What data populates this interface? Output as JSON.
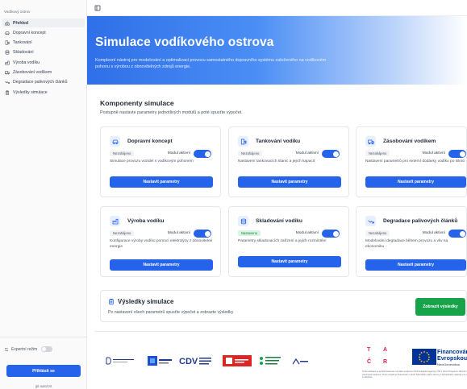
{
  "sidebar": {
    "title": "Vodíkový ostrov",
    "items": [
      {
        "label": "Přehled",
        "icon": "home-icon",
        "active": true
      },
      {
        "label": "Dopravní koncept",
        "icon": "car-icon",
        "active": false
      },
      {
        "label": "Tankování",
        "icon": "fuel-icon",
        "active": false
      },
      {
        "label": "Skladování",
        "icon": "database-icon",
        "active": false
      },
      {
        "label": "Výroba vodíku",
        "icon": "factory-icon",
        "active": false
      },
      {
        "label": "Zásobování vodíkem",
        "icon": "truck-icon",
        "active": false
      },
      {
        "label": "Degradace palivových článků",
        "icon": "trending-down-icon",
        "active": false
      },
      {
        "label": "Výsledky simulace",
        "icon": "clipboard-icon",
        "active": false
      }
    ],
    "expert_mode_label": "Expertní režim",
    "login_label": "Přihlásit se",
    "user_text": "git auto/1st"
  },
  "hero": {
    "title": "Simulace vodíkového ostrova",
    "description": "Komplexní nástroj pro modelování a optimalizaci provozu samostatného dopravního systému založeného na vodíkovém pohonu s výrobou z obnovitelných zdrojů energie."
  },
  "components": {
    "title": "Komponenty simulace",
    "subtitle": "Postupně nastavte parametry jednotlivých modulů a poté spusťte výpočet.",
    "module_active_label": "Modul aktivní",
    "button_label": "Nastavit parametry",
    "cards": [
      {
        "title": "Dopravní koncept",
        "status": "Nezahájeno",
        "desc": "Simulace provozu vozidel s vodíkovým pohonem",
        "icon": "car-icon"
      },
      {
        "title": "Tankování vodíku",
        "status": "Nezahájeno",
        "desc": "Nastavení tankovacích stanic a jejich kapacit",
        "icon": "fuel-icon"
      },
      {
        "title": "Zásobování vodíkem",
        "status": "Nezahájeno",
        "desc": "Nastavení parametrů pro externí dodávky vodíku po silnici",
        "icon": "truck-icon"
      },
      {
        "title": "Výroba vodíku",
        "status": "Nezahájeno",
        "desc": "Konfigurace výroby vodíku pomocí elektrolýzy z obnovitelné energie",
        "icon": "factory-icon"
      },
      {
        "title": "Skladování vodíku",
        "status": "Nastaveno",
        "desc": "Parametry skladovacích zařízení a jejich rozmístění",
        "icon": "database-icon"
      },
      {
        "title": "Degradace palivových článků",
        "status": "Nezahájeno",
        "desc": "Modelování degradace během provozu a vliv na ekonomiku",
        "icon": "trending-down-icon"
      }
    ]
  },
  "results": {
    "title": "Výsledky simulace",
    "description": "Po nastavení všech parametrů spusťte výpočet a zobrazte výsledky",
    "button_label": "Zobrazit výsledky"
  },
  "footer": {
    "eu_title_1": "Financováno",
    "eu_title_2": "Evropskou u",
    "eu_sub": "NextGeneration",
    "ta_letters": [
      "T",
      "A",
      "Č",
      "R"
    ],
    "ta_note": "Tento software je spolufinancován se státní podporou Technologické agentury ČR v rámci Programu Národní Centra kompetence. Tento projekt je financován v rámci Národního plánu obnovy z Evropského nástroje pro obnovu a odolnost."
  },
  "colors": {
    "primary": "#2563eb",
    "success": "#16a34a",
    "status_set_bg": "#d9f5e1",
    "eu_blue": "#003399"
  }
}
